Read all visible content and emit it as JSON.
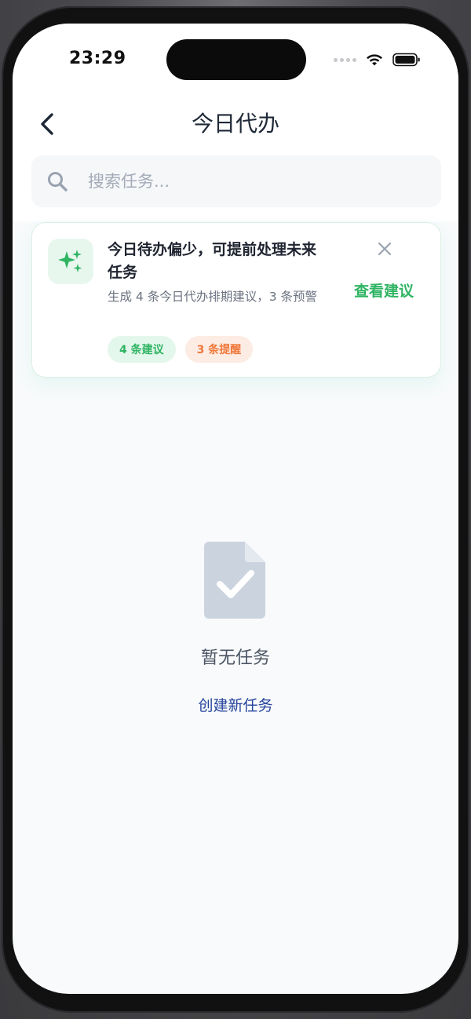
{
  "status_bar": {
    "time": "23:29"
  },
  "header": {
    "title": "今日代办"
  },
  "search": {
    "placeholder": "搜索任务..."
  },
  "ai_card": {
    "title": "今日待办偏少，可提前处理未来任务",
    "description": "生成 4 条今日代办排期建议，3 条预警",
    "tags": [
      {
        "label": "4 条建议"
      },
      {
        "label": "3 条提醒"
      }
    ],
    "action_label": "查看建议"
  },
  "empty_state": {
    "message": "暂无任务",
    "action_label": "创建新任务"
  },
  "icons": {
    "back": "chevron-left-icon",
    "search": "search-icon",
    "ai": "sparkles-icon",
    "close": "close-icon",
    "empty": "document-check-icon"
  },
  "colors": {
    "accent_green": "#2fb463",
    "accent_orange": "#f0783a",
    "link_blue": "#24439b",
    "background": "#f8fafc"
  }
}
